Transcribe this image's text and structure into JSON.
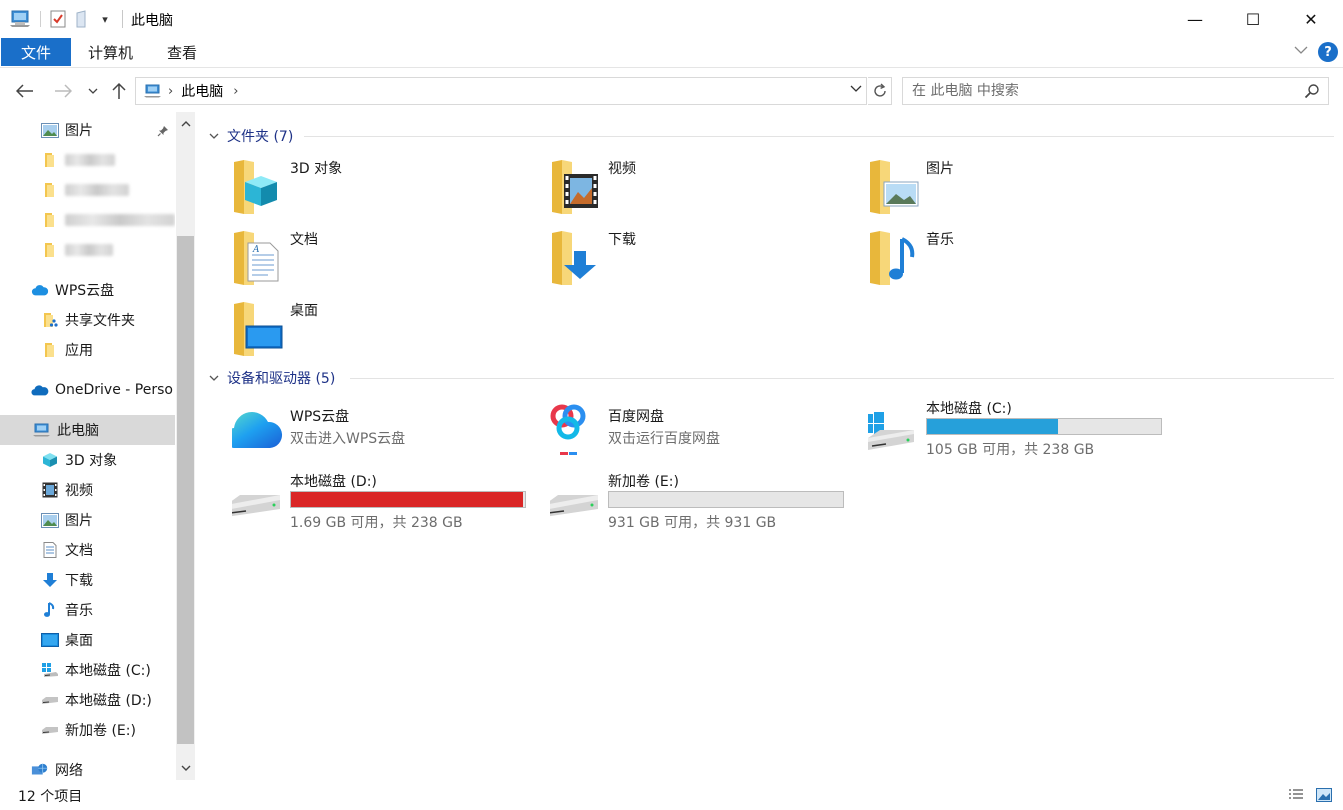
{
  "window": {
    "title": "此电脑",
    "minimize_glyph": "—",
    "maximize_glyph": "☐",
    "close_glyph": "✕"
  },
  "ribbon": {
    "tabs": [
      "文件",
      "计算机",
      "查看"
    ],
    "help_glyph": "?",
    "accent": "#1a6fc9"
  },
  "address": {
    "path": "此电脑",
    "search_placeholder": "在 此电脑 中搜索"
  },
  "sidebar": {
    "pictures_label": "图片",
    "wps_cloud": "WPS云盘",
    "shared_folder": "共享文件夹",
    "apps": "应用",
    "onedrive": "OneDrive - Perso",
    "this_pc": "此电脑",
    "items": [
      {
        "label": "3D 对象",
        "icon": "3d-objects-icon"
      },
      {
        "label": "视频",
        "icon": "video-icon"
      },
      {
        "label": "图片",
        "icon": "pictures-icon"
      },
      {
        "label": "文档",
        "icon": "documents-icon"
      },
      {
        "label": "下载",
        "icon": "downloads-icon"
      },
      {
        "label": "音乐",
        "icon": "music-icon"
      },
      {
        "label": "桌面",
        "icon": "desktop-icon"
      },
      {
        "label": "本地磁盘 (C:)",
        "icon": "windows-drive-icon"
      },
      {
        "label": "本地磁盘 (D:)",
        "icon": "drive-icon"
      },
      {
        "label": "新加卷 (E:)",
        "icon": "drive-icon"
      }
    ],
    "network": "网络"
  },
  "content": {
    "folders_header": "文件夹 (7)",
    "folders": [
      {
        "label": "3D 对象",
        "icon": "3d-objects-folder-icon"
      },
      {
        "label": "视频",
        "icon": "video-folder-icon"
      },
      {
        "label": "图片",
        "icon": "pictures-folder-icon"
      },
      {
        "label": "文档",
        "icon": "documents-folder-icon"
      },
      {
        "label": "下载",
        "icon": "downloads-folder-icon"
      },
      {
        "label": "音乐",
        "icon": "music-folder-icon"
      },
      {
        "label": "桌面",
        "icon": "desktop-folder-icon"
      }
    ],
    "devices_header": "设备和驱动器 (5)",
    "devices": [
      {
        "label": "WPS云盘",
        "sub": "双击进入WPS云盘",
        "icon": "wps-cloud-icon"
      },
      {
        "label": "百度网盘",
        "sub": "双击运行百度网盘",
        "icon": "baidu-netdisk-icon"
      },
      {
        "label": "本地磁盘 (C:)",
        "free": "105 GB 可用，共 238 GB",
        "used_fraction": 0.56,
        "bar_color": "#26a0da",
        "icon": "windows-drive-icon"
      },
      {
        "label": "本地磁盘 (D:)",
        "free": "1.69 GB 可用，共 238 GB",
        "used_fraction": 0.993,
        "bar_color": "#da2626",
        "icon": "drive-icon"
      },
      {
        "label": "新加卷 (E:)",
        "free": "931 GB 可用，共 931 GB",
        "used_fraction": 0.0,
        "bar_color": "#26a0da",
        "icon": "drive-icon"
      }
    ]
  },
  "status": {
    "item_count": "12 个项目"
  }
}
